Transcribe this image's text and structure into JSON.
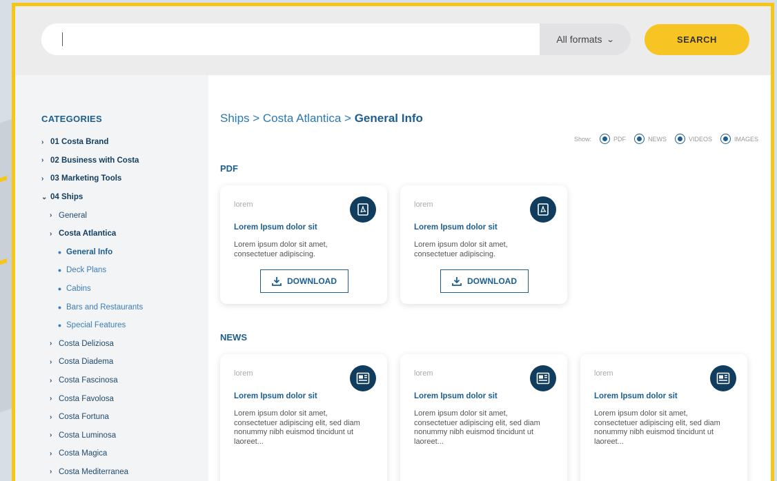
{
  "search": {
    "value": "",
    "placeholder": "",
    "format_label": "All formats",
    "button_label": "SEARCH"
  },
  "sidebar": {
    "title": "CATEGORIES",
    "items": [
      {
        "label": "01 Costa Brand",
        "level": 0,
        "marker": "›"
      },
      {
        "label": "02 Business with Costa",
        "level": 0,
        "marker": "›"
      },
      {
        "label": "03 Marketing Tools",
        "level": 0,
        "marker": "›"
      },
      {
        "label": "04 Ships",
        "level": 0,
        "marker": "⌄"
      },
      {
        "label": "General",
        "level": 1,
        "marker": "›"
      },
      {
        "label": "Costa Atlantica",
        "level": 1,
        "marker": "›",
        "active": true
      },
      {
        "label": "General Info",
        "level": 2,
        "marker": "•",
        "active": true
      },
      {
        "label": "Deck Plans",
        "level": 2,
        "marker": "•"
      },
      {
        "label": "Cabins",
        "level": 2,
        "marker": "•"
      },
      {
        "label": "Bars and Restaurants",
        "level": 2,
        "marker": "•"
      },
      {
        "label": "Special Features",
        "level": 2,
        "marker": "•"
      },
      {
        "label": "Costa Deliziosa",
        "level": 1,
        "marker": "›"
      },
      {
        "label": "Costa Diadema",
        "level": 1,
        "marker": "›"
      },
      {
        "label": "Costa Fascinosa",
        "level": 1,
        "marker": "›"
      },
      {
        "label": "Costa Favolosa",
        "level": 1,
        "marker": "›"
      },
      {
        "label": "Costa Fortuna",
        "level": 1,
        "marker": "›"
      },
      {
        "label": "Costa Luminosa",
        "level": 1,
        "marker": "›"
      },
      {
        "label": "Costa Magica",
        "level": 1,
        "marker": "›"
      },
      {
        "label": "Costa Mediterranea",
        "level": 1,
        "marker": "›"
      }
    ]
  },
  "breadcrumb": {
    "part1": "Ships",
    "sep1": " > ",
    "part2": "Costa Atlantica",
    "sep2": " > ",
    "current": "General Info"
  },
  "filters": {
    "show_label": "Show:",
    "options": [
      "PDF",
      "NEWS",
      "VIDEOS",
      "IMAGES"
    ]
  },
  "pdf_section": {
    "title": "PDF",
    "cards": [
      {
        "kicker": "lorem",
        "title": "Lorem Ipsum dolor sit",
        "desc": "Lorem ipsum dolor sit amet, consectetuer adipiscing.",
        "button": "DOWNLOAD",
        "icon": "pdf-icon"
      },
      {
        "kicker": "lorem",
        "title": "Lorem Ipsum dolor sit",
        "desc": "Lorem ipsum dolor sit amet, consectetuer adipiscing.",
        "button": "DOWNLOAD",
        "icon": "pdf-icon"
      }
    ]
  },
  "news_section": {
    "title": "NEWS",
    "cards": [
      {
        "kicker": "lorem",
        "title": "Lorem Ipsum dolor sit",
        "desc": "Lorem ipsum dolor sit amet, consectetuer adipiscing elit, sed diam nonummy nibh euismod tincidunt ut laoreet...",
        "icon": "newspaper-icon"
      },
      {
        "kicker": "lorem",
        "title": "Lorem Ipsum dolor sit",
        "desc": "Lorem ipsum dolor sit amet, consectetuer adipiscing elit, sed diam nonummy nibh euismod tincidunt ut laoreet...",
        "icon": "newspaper-icon"
      },
      {
        "kicker": "lorem",
        "title": "Lorem Ipsum dolor sit",
        "desc": "Lorem ipsum dolor sit amet, consectetuer adipiscing elit, sed diam nonummy nibh euismod tincidunt ut laoreet...",
        "icon": "newspaper-icon"
      }
    ]
  },
  "colors": {
    "accent": "#f6c523",
    "primary": "#1b5e8f",
    "icon_bg": "#103d5e"
  }
}
